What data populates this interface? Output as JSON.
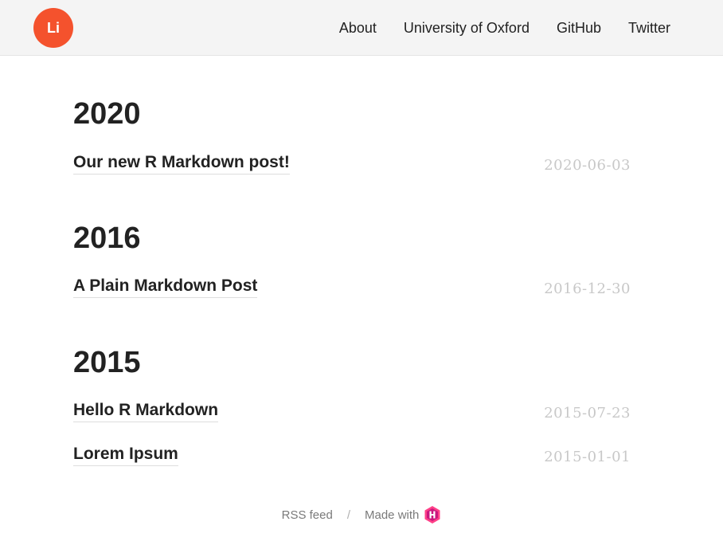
{
  "header": {
    "logo_text": "Li",
    "logo_color": "#f4522d",
    "nav": [
      {
        "label": "About"
      },
      {
        "label": "University of Oxford"
      },
      {
        "label": "GitHub"
      },
      {
        "label": "Twitter"
      }
    ]
  },
  "sections": [
    {
      "year": "2020",
      "posts": [
        {
          "title": "Our new R Markdown post!",
          "date": "2020-06-03"
        }
      ]
    },
    {
      "year": "2016",
      "posts": [
        {
          "title": "A Plain Markdown Post",
          "date": "2016-12-30"
        }
      ]
    },
    {
      "year": "2015",
      "posts": [
        {
          "title": "Hello R Markdown",
          "date": "2015-07-23"
        },
        {
          "title": "Lorem Ipsum",
          "date": "2015-01-01"
        }
      ]
    }
  ],
  "footer": {
    "rss_label": "RSS feed",
    "separator": "/",
    "made_with_label": "Made with",
    "made_with_icon": "hugo-logo-icon",
    "icon_color": "#ff4088"
  }
}
